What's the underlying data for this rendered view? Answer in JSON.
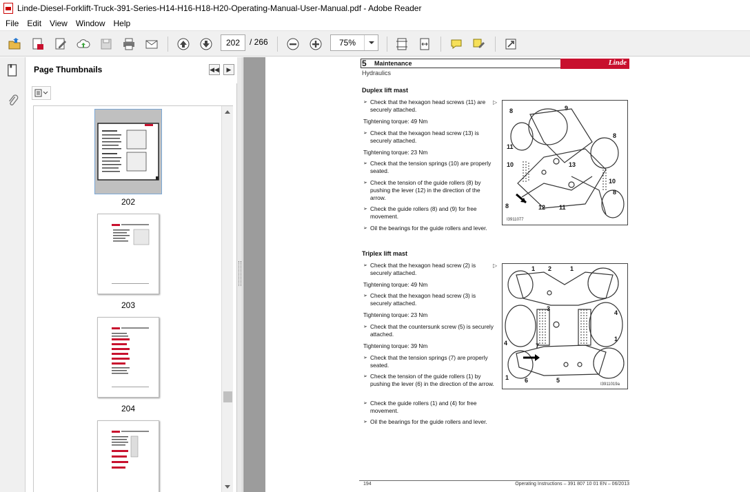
{
  "window": {
    "title": "Linde-Diesel-Forklift-Truck-391-Series-H14-H16-H18-H20-Operating-Manual-User-Manual.pdf - Adobe Reader"
  },
  "menu": [
    "File",
    "Edit",
    "View",
    "Window",
    "Help"
  ],
  "toolbar": {
    "current_page": "202",
    "total_pages": "/ 266",
    "zoom": "75%"
  },
  "thumbnails": {
    "title": "Page Thumbnails",
    "pages": [
      "202",
      "203",
      "204"
    ]
  },
  "document": {
    "chapter_number": "5",
    "chapter_title": "Maintenance",
    "section": "Hydraulics",
    "logo": "Linde",
    "duplex": {
      "heading": "Duplex lift mast",
      "steps": [
        "Check that the hexagon head screws (11) are securely attached.",
        "Tightening torque: 49 Nm",
        "Check that the hexagon head screw (13) is securely attached.",
        "Tightening torque: 23 Nm",
        "Check that the tension springs (10) are properly seated.",
        "Check the tension of the guide rollers (8) by pushing the lever (12) in the direction of the arrow.",
        "Check the guide rollers (8) and (9) for free movement.",
        "Oil the bearings for the guide rollers and lever."
      ],
      "figure_code": "I3911077",
      "labels": [
        "8",
        "9",
        "8",
        "11",
        "10",
        "13",
        "10",
        "8",
        "8",
        "12",
        "11"
      ]
    },
    "triplex": {
      "heading": "Triplex lift mast",
      "steps": [
        "Check that the hexagon head screw (2) is securely attached.",
        "Tightening torque: 49 Nm",
        "Check that the hexagon head screw (3) is securely attached.",
        "Tightening torque: 23 Nm",
        "Check that the countersunk screw (5) is securely attached.",
        "Tightening torque: 39 Nm",
        "Check that the tension springs (7) are properly seated.",
        "Check the tension of the guide rollers (1) by pushing the lever (6) in the direction of the arrow.",
        "Check the guide rollers (1) and (4) for free movement.",
        "Oil the bearings for the guide rollers and lever."
      ],
      "figure_code": "I3911019a",
      "labels": [
        "1",
        "2",
        "1",
        "3",
        "4",
        "4",
        "7",
        "1",
        "1",
        "6",
        "5"
      ]
    },
    "footer_page": "194",
    "footer_ref": "Operating Instructions – 391 807 10 01 EN – 06/2013"
  },
  "colors": {
    "brand_red": "#c8102e",
    "doc_background": "#9c9c9c"
  }
}
